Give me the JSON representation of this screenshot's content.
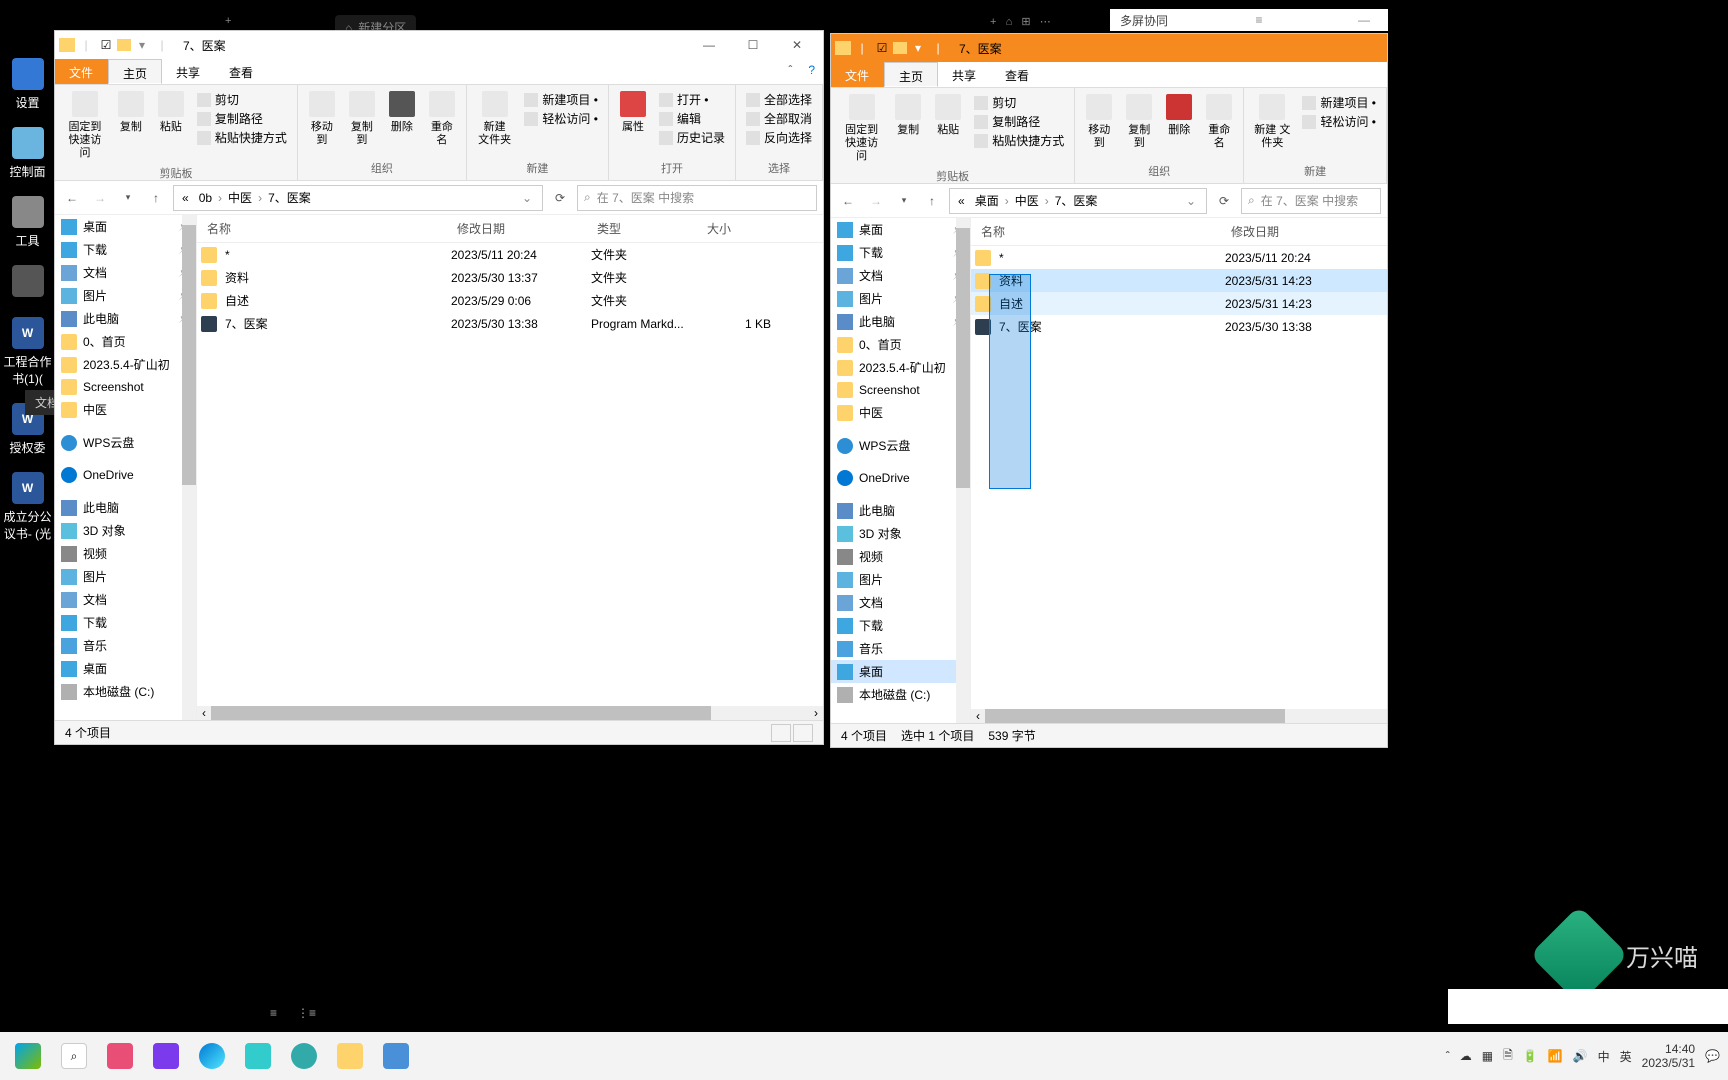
{
  "desktop_icons": [
    {
      "label": "设置"
    },
    {
      "label": "控制面"
    },
    {
      "label": "工具"
    },
    {
      "label": ""
    },
    {
      "label": "文档"
    },
    {
      "label": "工程合作书(1)("
    },
    {
      "label": "授权委"
    },
    {
      "label": "成立分公议书- (光"
    }
  ],
  "bg_tab1": "新建分区",
  "multiscreen": {
    "title": "多屏协同"
  },
  "other_sidebar": "文档",
  "left": {
    "title": "7、医案",
    "tabs": {
      "file": "文件",
      "home": "主页",
      "share": "共享",
      "view": "查看"
    },
    "ribbon": {
      "pin": "固定到\n快速访问",
      "copy": "复制",
      "paste": "粘贴",
      "cut": "剪切",
      "copypath": "复制路径",
      "pasteshort": "粘贴快捷方式",
      "clipboard": "剪贴板",
      "moveto": "移动到",
      "copyto": "复制到",
      "delete": "删除",
      "rename": "重命名",
      "organize": "组织",
      "newfolder": "新建\n文件夹",
      "newitem": "新建项目 •",
      "easyaccess": "轻松访问 •",
      "new": "新建",
      "properties": "属性",
      "open": "打开 •",
      "edit": "编辑",
      "history": "历史记录",
      "opengrp": "打开",
      "selectall": "全部选择",
      "selectnone": "全部取消",
      "invert": "反向选择",
      "select": "选择"
    },
    "breadcrumb": [
      "0b",
      "中医",
      "7、医案"
    ],
    "search_ph": "在 7、医案 中搜索",
    "cols": {
      "name": "名称",
      "date": "修改日期",
      "type": "类型",
      "size": "大小"
    },
    "nav": [
      {
        "ic": "ic-desktop",
        "label": "桌面",
        "pin": true
      },
      {
        "ic": "ic-dl",
        "label": "下载",
        "pin": true
      },
      {
        "ic": "ic-doc",
        "label": "文档",
        "pin": true
      },
      {
        "ic": "ic-pic",
        "label": "图片",
        "pin": true
      },
      {
        "ic": "ic-pc",
        "label": "此电脑",
        "pin": true
      },
      {
        "ic": "ic-folder",
        "label": "0、首页"
      },
      {
        "ic": "ic-folder",
        "label": "2023.5.4-矿山初"
      },
      {
        "ic": "ic-folder",
        "label": "Screenshot"
      },
      {
        "ic": "ic-folder",
        "label": "中医"
      },
      {
        "spacer": true
      },
      {
        "ic": "ic-cloud",
        "label": "WPS云盘"
      },
      {
        "spacer": true
      },
      {
        "ic": "ic-onedrive",
        "label": "OneDrive"
      },
      {
        "spacer": true
      },
      {
        "ic": "ic-pc",
        "label": "此电脑"
      },
      {
        "ic": "ic-3d",
        "label": "3D 对象"
      },
      {
        "ic": "ic-video",
        "label": "视频"
      },
      {
        "ic": "ic-pic",
        "label": "图片"
      },
      {
        "ic": "ic-doc",
        "label": "文档"
      },
      {
        "ic": "ic-dl",
        "label": "下载"
      },
      {
        "ic": "ic-music",
        "label": "音乐"
      },
      {
        "ic": "ic-desktop",
        "label": "桌面"
      },
      {
        "ic": "ic-disk",
        "label": "本地磁盘 (C:)"
      }
    ],
    "files": [
      {
        "ic": "ic-folder",
        "name": "*",
        "date": "2023/5/11 20:24",
        "type": "文件夹",
        "size": ""
      },
      {
        "ic": "ic-folder",
        "name": "资料",
        "date": "2023/5/30 13:37",
        "type": "文件夹",
        "size": ""
      },
      {
        "ic": "ic-folder",
        "name": "自述",
        "date": "2023/5/29 0:06",
        "type": "文件夹",
        "size": ""
      },
      {
        "ic": "ic-md",
        "name": "7、医案",
        "date": "2023/5/30 13:38",
        "type": "Program Markd...",
        "size": "1 KB"
      }
    ],
    "status": "4 个项目"
  },
  "right": {
    "title": "7、医案",
    "tabs": {
      "file": "文件",
      "home": "主页",
      "share": "共享",
      "view": "查看"
    },
    "ribbon": {
      "pin": "固定到\n快速访问",
      "copy": "复制",
      "paste": "粘贴",
      "cut": "剪切",
      "copypath": "复制路径",
      "pasteshort": "粘贴快捷方式",
      "clipboard": "剪贴板",
      "moveto": "移动到",
      "copyto": "复制到",
      "delete": "删除",
      "rename": "重命名",
      "organize": "组织",
      "newfolder": "新建\n文件夹",
      "newitem": "新建项目 •",
      "easyaccess": "轻松访问 •",
      "new": "新建"
    },
    "breadcrumb": [
      "桌面",
      "中医",
      "7、医案"
    ],
    "search_ph": "在 7、医案 中搜索",
    "cols": {
      "name": "名称",
      "date": "修改日期"
    },
    "nav": [
      {
        "ic": "ic-desktop",
        "label": "桌面",
        "pin": true
      },
      {
        "ic": "ic-dl",
        "label": "下载",
        "pin": true
      },
      {
        "ic": "ic-doc",
        "label": "文档",
        "pin": true
      },
      {
        "ic": "ic-pic",
        "label": "图片",
        "pin": true
      },
      {
        "ic": "ic-pc",
        "label": "此电脑",
        "pin": true
      },
      {
        "ic": "ic-folder",
        "label": "0、首页"
      },
      {
        "ic": "ic-folder",
        "label": "2023.5.4-矿山初"
      },
      {
        "ic": "ic-folder",
        "label": "Screenshot"
      },
      {
        "ic": "ic-folder",
        "label": "中医"
      },
      {
        "spacer": true
      },
      {
        "ic": "ic-cloud",
        "label": "WPS云盘"
      },
      {
        "spacer": true
      },
      {
        "ic": "ic-onedrive",
        "label": "OneDrive"
      },
      {
        "spacer": true
      },
      {
        "ic": "ic-pc",
        "label": "此电脑"
      },
      {
        "ic": "ic-3d",
        "label": "3D 对象"
      },
      {
        "ic": "ic-video",
        "label": "视频"
      },
      {
        "ic": "ic-pic",
        "label": "图片"
      },
      {
        "ic": "ic-doc",
        "label": "文档"
      },
      {
        "ic": "ic-dl",
        "label": "下载"
      },
      {
        "ic": "ic-music",
        "label": "音乐"
      },
      {
        "ic": "ic-desktop",
        "label": "桌面",
        "hl": true
      },
      {
        "ic": "ic-disk",
        "label": "本地磁盘 (C:)"
      }
    ],
    "files": [
      {
        "ic": "ic-folder",
        "name": "*",
        "date": "2023/5/11 20:24"
      },
      {
        "ic": "ic-folder",
        "name": "资料",
        "date": "2023/5/31 14:23",
        "sel": true
      },
      {
        "ic": "ic-folder",
        "name": "自述",
        "date": "2023/5/31 14:23",
        "hl": true
      },
      {
        "ic": "ic-md",
        "name": "7、医案",
        "date": "2023/5/30 13:38"
      }
    ],
    "status": "4 个项目",
    "status2": "选中 1 个项目",
    "status3": "539 字节"
  },
  "taskbar": {
    "time": "14:40",
    "date": "2023/5/31",
    "ime": "英",
    "lang": "中"
  },
  "watermark": "万兴喵"
}
